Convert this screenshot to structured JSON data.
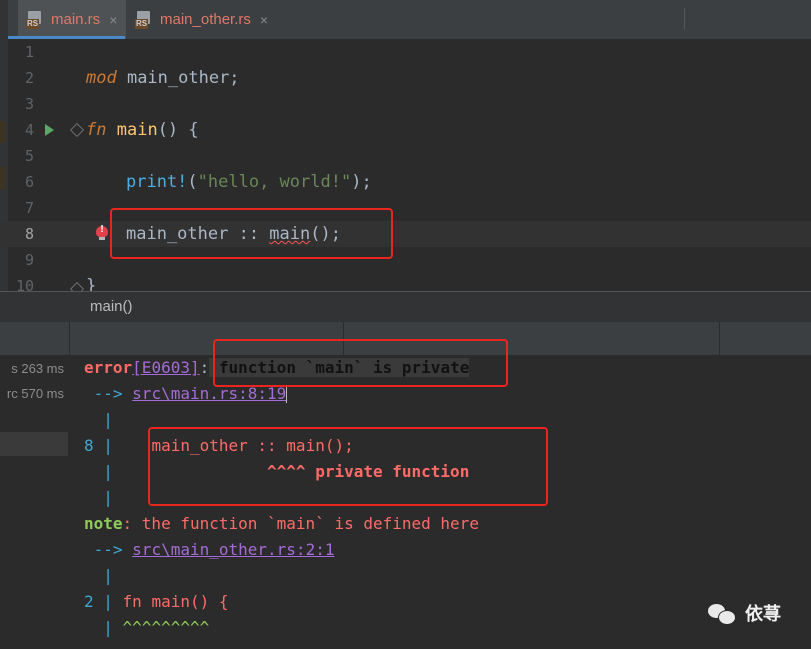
{
  "tabs": [
    {
      "label": "main.rs",
      "icon": "rust-file-icon",
      "active": true
    },
    {
      "label": "main_other.rs",
      "icon": "rust-file-icon",
      "active": false
    }
  ],
  "tab_close_glyph": "×",
  "rs_icon_label": "RS",
  "editor": {
    "line_numbers": [
      "1",
      "2",
      "3",
      "4",
      "5",
      "6",
      "7",
      "8",
      "9",
      "10"
    ],
    "lines": {
      "l2": {
        "kw": "mod",
        "rest": " main_other;"
      },
      "l4": {
        "kw": "fn",
        "name": "main",
        "rest": "() {"
      },
      "l6": {
        "macro": "print!",
        "open": "(",
        "string": "\"hello, world!\"",
        "close": ");"
      },
      "l8": {
        "prefix": "main_other :: ",
        "call": "main",
        "rest": "();"
      },
      "l10": {
        "text": "}"
      }
    },
    "current_line": 8
  },
  "breadcrumb": {
    "text": "main()"
  },
  "run_panel": {
    "timings": [
      {
        "text": "s 263 ms"
      },
      {
        "text": "rc 570 ms"
      }
    ],
    "output": {
      "e_prefix": "error",
      "e_code": "[E0603]",
      "e_colon": ":",
      "e_msg": " function `main` is private",
      "arrow1": " --> ",
      "loc1": "src\\main.rs:8:19",
      "pipe": "  |",
      "l8_num": "8 |",
      "l8_code": "    main_other :: main();",
      "l8_mark": "                ^^^^ private function",
      "note_label": "note",
      "note_msg": ": the function `main` is defined here",
      "arrow2": " --> ",
      "loc2": "src\\main_other.rs:2:1",
      "l2_num": "2 |",
      "l2_code": " fn main() {",
      "l2_mark_pipe": "  |",
      "l2_mark": " ^^^^^^^^^"
    }
  },
  "watermark": {
    "text": "依荨"
  },
  "colors": {
    "annotation_box": "#e8251f",
    "error_text": "#ff6b68",
    "link": "#a56bd6",
    "arrow_blue": "#3ea9d3",
    "active_tab_underline": "#4a88c7"
  }
}
